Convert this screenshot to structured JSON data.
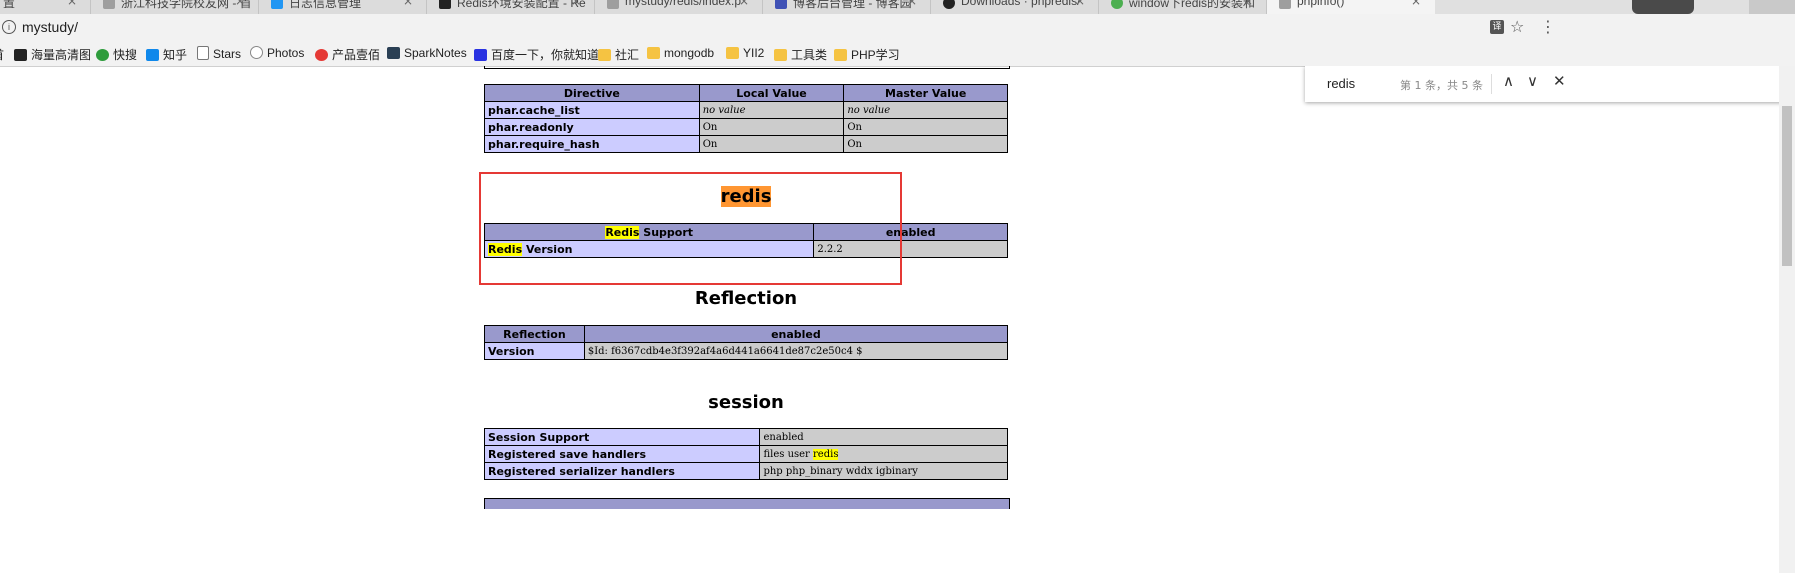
{
  "browser": {
    "tabs": [
      {
        "title": "置",
        "icon_color": "#3a7bd5"
      },
      {
        "title": "浙江科技学院校友网 - 首",
        "icon_color": "#9e9e9e"
      },
      {
        "title": "日志信息管理",
        "icon_color": "#2196f3"
      },
      {
        "title": "Redis环境安装配置 - Re",
        "icon_color": "#222222"
      },
      {
        "title": "mystudy/redis/index.p",
        "icon_color": "#9e9e9e"
      },
      {
        "title": "博客后台管理 - 博客园",
        "icon_color": "#3f51b5"
      },
      {
        "title": "Downloads · phpredis/",
        "icon_color": "#222222"
      },
      {
        "title": "window下redis的安装和",
        "icon_color": "#4caf50"
      },
      {
        "title": "phpinfo()",
        "icon_color": "#9e9e9e"
      }
    ],
    "tab_close_glyph": "×",
    "url": "mystudy/",
    "bookmarks": [
      {
        "label": "首",
        "icon": "none"
      },
      {
        "label": "海量高清图",
        "icon": "camera-icon"
      },
      {
        "label": "快搜",
        "icon": "search-icon"
      },
      {
        "label": "知乎",
        "icon": "zhihu-icon"
      },
      {
        "label": "Stars",
        "icon": "page-icon"
      },
      {
        "label": "Photos",
        "icon": "photos-icon"
      },
      {
        "label": "产品壹佰",
        "icon": "brand-icon"
      },
      {
        "label": "SparkNotes",
        "icon": "sparknotes-icon"
      },
      {
        "label": "百度一下，你就知道",
        "icon": "baidu-icon"
      },
      {
        "label": "社汇",
        "icon": "folder-icon"
      },
      {
        "label": "mongodb",
        "icon": "folder-icon"
      },
      {
        "label": "YII2",
        "icon": "folder-icon"
      },
      {
        "label": "工具类",
        "icon": "folder-icon"
      },
      {
        "label": "PHP学习",
        "icon": "folder-icon"
      }
    ],
    "find": {
      "query": "redis",
      "count": "第 1 条，共 5 条",
      "prev_glyph": "∧",
      "next_glyph": "∨",
      "close_glyph": "✕"
    }
  },
  "phpinfo": {
    "phar_table": {
      "headers": [
        "Directive",
        "Local Value",
        "Master Value"
      ],
      "rows": [
        {
          "name": "phar.cache_list",
          "local": "no value",
          "master": "no value"
        },
        {
          "name": "phar.readonly",
          "local": "On",
          "master": "On"
        },
        {
          "name": "phar.require_hash",
          "local": "On",
          "master": "On"
        }
      ]
    },
    "redis": {
      "title": "redis",
      "header_hl": "Redis",
      "header_rest": " Support",
      "header_value": "enabled",
      "row_hl": "Redis",
      "row_rest": " Version",
      "row_value": "2.2.2"
    },
    "reflection": {
      "title": "Reflection",
      "headers": [
        "Reflection",
        "enabled"
      ],
      "row_name": "Version",
      "row_value": "$Id: f6367cdb4e3f392af4a6d441a6641de87c2e50c4 $"
    },
    "session": {
      "title": "session",
      "rows": [
        {
          "name": "Session Support",
          "value": "enabled"
        },
        {
          "name": "Registered save handlers",
          "value_pre": "files user ",
          "value_hl": "redis"
        },
        {
          "name": "Registered serializer handlers",
          "value": "php php_binary wddx igbinary"
        }
      ]
    }
  },
  "colors": {
    "header_bg": "#9999cc",
    "entry_bg": "#ccccff",
    "value_bg": "#cccccc",
    "highlight_match": "#ffff00",
    "highlight_current": "#ff9632",
    "annotation_box": "#e53935"
  }
}
